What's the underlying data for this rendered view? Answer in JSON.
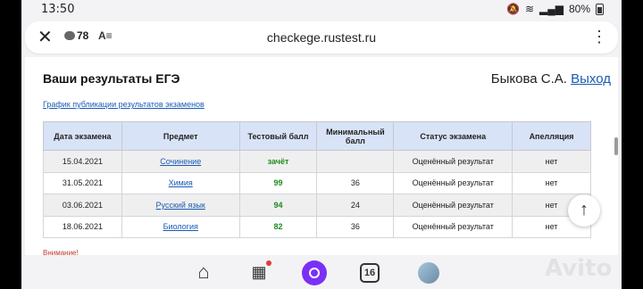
{
  "status_bar": {
    "time": "13:50",
    "battery": "80%"
  },
  "browser": {
    "comment_count": "78",
    "url": "checkege.rustest.ru",
    "reader_label": "A≡"
  },
  "page": {
    "title": "Ваши результаты ЕГЭ",
    "user_name": "Быкова С.А.",
    "logout_label": "Выход",
    "schedule_link": "График публикации результатов экзаменов",
    "table": {
      "headers": [
        "Дата экзамена",
        "Предмет",
        "Тестовый балл",
        "Минимальный балл",
        "Статус экзамена",
        "Апелляция"
      ],
      "rows": [
        {
          "date": "15.04.2021",
          "subject": "Сочинение",
          "score": "зачёт",
          "min_score": "",
          "status": "Оценённый результат",
          "appeal": "нет"
        },
        {
          "date": "31.05.2021",
          "subject": "Химия",
          "score": "99",
          "min_score": "36",
          "status": "Оценённый результат",
          "appeal": "нет"
        },
        {
          "date": "03.06.2021",
          "subject": "Русский язык",
          "score": "94",
          "min_score": "24",
          "status": "Оценённый результат",
          "appeal": "нет"
        },
        {
          "date": "18.06.2021",
          "subject": "Биология",
          "score": "82",
          "min_score": "36",
          "status": "Оценённый результат",
          "appeal": "нет"
        }
      ]
    },
    "warning": "Внимание!"
  },
  "bottom_nav": {
    "tabs_count": "16"
  },
  "watermark": "Avito",
  "icons": [
    "close-icon",
    "comment-icon",
    "reader-icon",
    "menu-icon",
    "scroll-top-icon",
    "home-icon",
    "services-icon",
    "alice-icon",
    "tabs-icon",
    "profile-icon"
  ],
  "colors": {
    "link": "#1a5bb5",
    "score": "#1e8a1e",
    "header_bg": "#d9e3f7",
    "warning": "#c0392b"
  }
}
